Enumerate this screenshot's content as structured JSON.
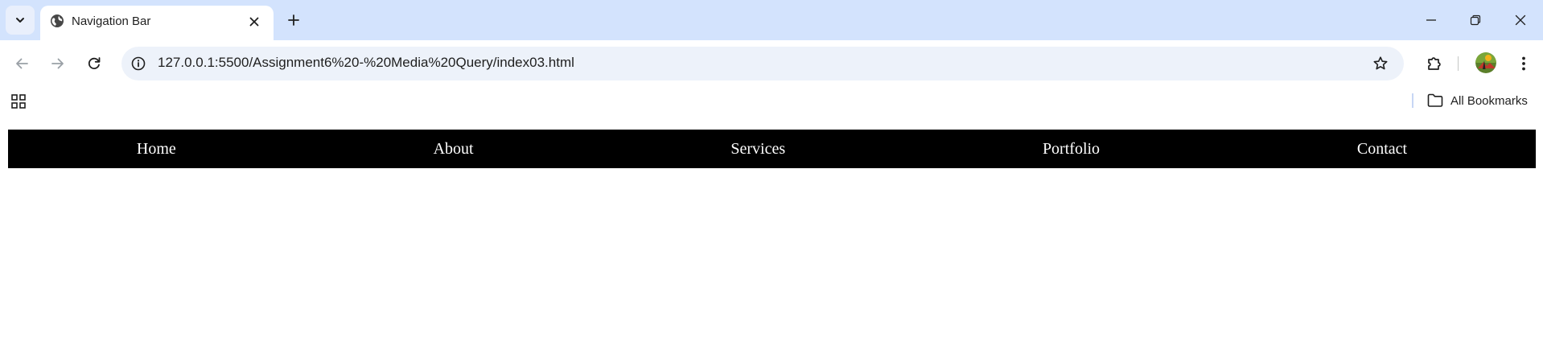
{
  "browser": {
    "tab": {
      "title": "Navigation Bar",
      "favicon": "globe-icon"
    },
    "address_bar": {
      "url": "127.0.0.1:5500/Assignment6%20-%20Media%20Query/index03.html"
    },
    "bookmarks_bar": {
      "all_bookmarks_label": "All Bookmarks"
    },
    "colors": {
      "tabstrip": "#d3e3fd",
      "omnibox": "#edf2fa"
    }
  },
  "page": {
    "navbar": {
      "background": "#000000",
      "links": [
        {
          "label": "Home"
        },
        {
          "label": "About"
        },
        {
          "label": "Services"
        },
        {
          "label": "Portfolio"
        },
        {
          "label": "Contact"
        }
      ]
    }
  }
}
